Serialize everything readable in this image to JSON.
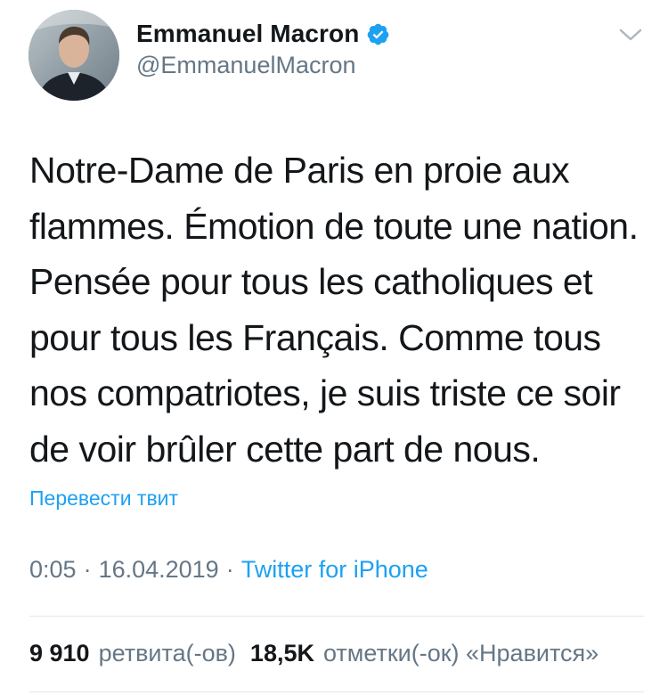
{
  "author": {
    "display_name": "Emmanuel Macron",
    "handle": "@EmmanuelMacron",
    "verified": true
  },
  "icons": {
    "verified": "verified-badge-icon",
    "menu": "chevron-down-icon"
  },
  "tweet": {
    "text": "Notre-Dame de Paris en proie aux\nflammes. Émotion de toute une nation.\nPensée pour tous les catholiques et\npour tous les Français. Comme tous\nnos compatriotes, je suis triste ce soir\nde voir brûler cette part de nous.",
    "translate_label": "Перевести твит",
    "time": "0:05",
    "separator": "·",
    "date": "16.04.2019",
    "source": "Twitter for iPhone"
  },
  "stats": {
    "retweets_count": "9 910",
    "retweets_label": "ретвита(-ов)",
    "likes_count": "18,5K",
    "likes_label": "отметки(-ок) «Нравится»"
  },
  "colors": {
    "link": "#1da1f2",
    "secondary_text": "#657786",
    "primary_text": "#14171a",
    "divider": "#e1e8ed"
  }
}
